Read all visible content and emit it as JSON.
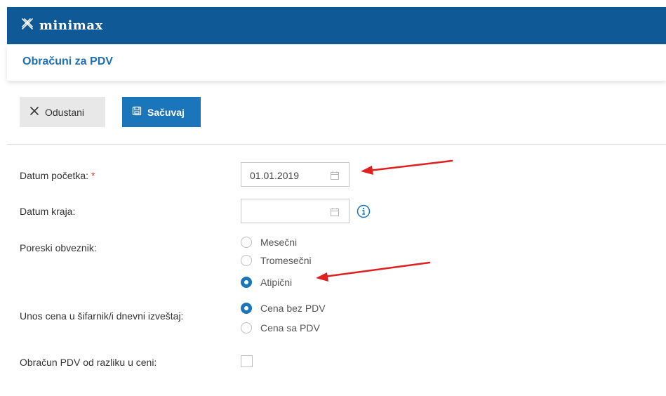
{
  "app": {
    "logo_text": "minimax"
  },
  "page": {
    "title": "Obračuni za PDV"
  },
  "toolbar": {
    "cancel_label": "Odustani",
    "save_label": "Sačuvaj"
  },
  "form": {
    "start_date": {
      "label": "Datum početka:",
      "required_mark": "*",
      "value": "01.01.2019"
    },
    "end_date": {
      "label": "Datum kraja:",
      "value": ""
    },
    "taxpayer": {
      "label": "Poreski obveznik:",
      "options": [
        {
          "label": "Mesečni",
          "selected": false
        },
        {
          "label": "Tromesečni",
          "selected": false
        },
        {
          "label": "Atipični",
          "selected": true
        }
      ]
    },
    "price_entry": {
      "label": "Unos cena u šifarnik/i dnevni izveštaj:",
      "options": [
        {
          "label": "Cena bez PDV",
          "selected": true
        },
        {
          "label": "Cena sa PDV",
          "selected": false
        }
      ]
    },
    "margin_vat": {
      "label": "Obračun PDV od razliku u ceni:",
      "checked": false
    }
  },
  "colors": {
    "brand": "#0f5a96",
    "accent": "#1b75bb",
    "annotation": "#e02020"
  },
  "icons": [
    "minimax-logo-icon",
    "close-icon",
    "save-icon",
    "calendar-icon",
    "info-icon"
  ]
}
